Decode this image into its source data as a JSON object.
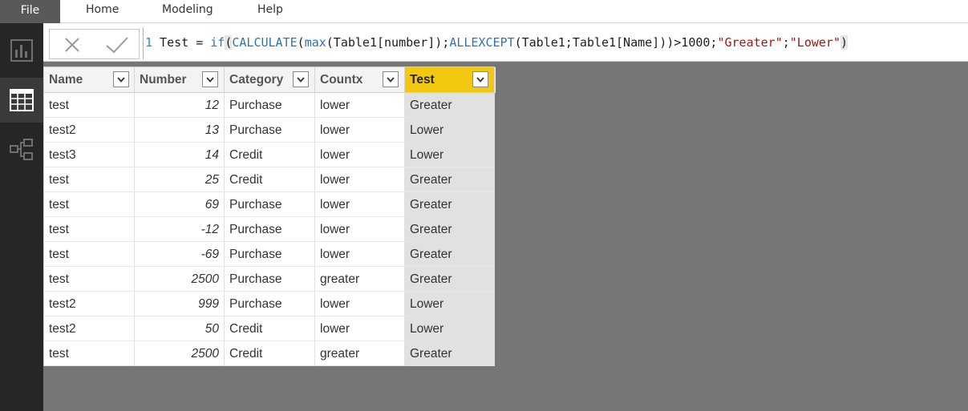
{
  "ribbon": {
    "file_label": "File",
    "menu": [
      "Home",
      "Modeling",
      "Help"
    ]
  },
  "rail": {
    "items": [
      {
        "name": "report-view",
        "icon": "bar-chart-icon",
        "active": false
      },
      {
        "name": "data-view",
        "icon": "table-grid-icon",
        "active": true
      },
      {
        "name": "relationships-view",
        "icon": "relationships-icon",
        "active": false
      }
    ]
  },
  "formula": {
    "cancel_icon": "close-icon",
    "commit_icon": "check-icon",
    "line_number": "1",
    "parts": {
      "p1": " Test = ",
      "p2": "if",
      "p3": "(",
      "p4": "CALCULATE",
      "p5": "(",
      "p6": "max",
      "p7": "(Table1[number]);",
      "p8": "ALLEXCEPT",
      "p9": "(Table1;Table1[Name]))>1000;",
      "p10": "\"Greater\"",
      "p11": ";",
      "p12": "\"Lower\"",
      "p13": ")"
    }
  },
  "table": {
    "columns": [
      "Name",
      "Number",
      "Category",
      "Countx",
      "Test"
    ],
    "selected_column": "Test",
    "rows": [
      [
        "test",
        "12",
        "Purchase",
        "lower",
        "Greater"
      ],
      [
        "test2",
        "13",
        "Purchase",
        "lower",
        "Lower"
      ],
      [
        "test3",
        "14",
        "Credit",
        "lower",
        "Lower"
      ],
      [
        "test",
        "25",
        "Credit",
        "lower",
        "Greater"
      ],
      [
        "test",
        "69",
        "Purchase",
        "lower",
        "Greater"
      ],
      [
        "test",
        "-12",
        "Purchase",
        "lower",
        "Greater"
      ],
      [
        "test",
        "-69",
        "Purchase",
        "lower",
        "Greater"
      ],
      [
        "test",
        "2500",
        "Purchase",
        "greater",
        "Greater"
      ],
      [
        "test2",
        "999",
        "Purchase",
        "lower",
        "Lower"
      ],
      [
        "test2",
        "50",
        "Credit",
        "lower",
        "Lower"
      ],
      [
        "test",
        "2500",
        "Credit",
        "greater",
        "Greater"
      ]
    ]
  },
  "colors": {
    "accent": "#f2c811",
    "rail": "#262626",
    "canvas": "#767676",
    "file_tab": "#595959"
  }
}
